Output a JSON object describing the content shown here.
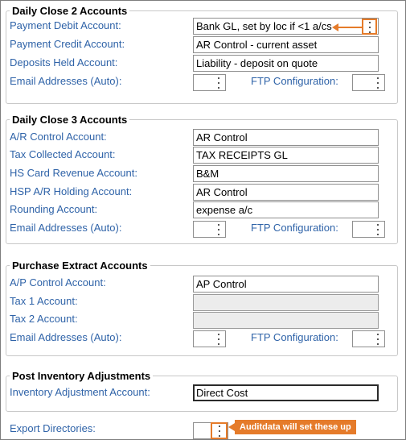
{
  "dc2": {
    "title": "Daily Close 2 Accounts",
    "payment_debit_label": "Payment Debit Account:",
    "payment_debit_value": "Bank GL, set by loc if <1 a/cs",
    "payment_credit_label": "Payment Credit Account:",
    "payment_credit_value": "AR Control - current asset",
    "deposits_held_label": "Deposits Held Account:",
    "deposits_held_value": "Liability - deposit on quote",
    "email_label": "Email Addresses (Auto):",
    "ftp_label": "FTP Configuration:"
  },
  "dc3": {
    "title": "Daily Close 3 Accounts",
    "ar_control_label": "A/R Control Account:",
    "ar_control_value": "AR Control",
    "tax_collected_label": "Tax Collected Account:",
    "tax_collected_value": "TAX RECEIPTS GL",
    "hs_card_label": "HS Card Revenue Account:",
    "hs_card_value": "B&M",
    "hsp_ar_label": "HSP A/R Holding Account:",
    "hsp_ar_value": "AR Control",
    "rounding_label": "Rounding Account:",
    "rounding_value": "expense a/c",
    "email_label": "Email Addresses (Auto):",
    "ftp_label": "FTP Configuration:"
  },
  "purchase": {
    "title": "Purchase Extract Accounts",
    "ap_control_label": "A/P Control Account:",
    "ap_control_value": "AP Control",
    "tax1_label": "Tax 1 Account:",
    "tax1_value": "",
    "tax2_label": "Tax 2 Account:",
    "tax2_value": "",
    "email_label": "Email Addresses (Auto):",
    "ftp_label": "FTP Configuration:"
  },
  "inventory": {
    "title": "Post Inventory Adjustments",
    "adjustment_label": "Inventory Adjustment Account:",
    "adjustment_value": "Direct Cost"
  },
  "export": {
    "label": "Export Directories:",
    "callout": "Auditdata will set these up"
  },
  "colors": {
    "label_blue": "#2f63a8",
    "highlight_orange": "#e57b2a"
  },
  "icons": {
    "picker": "vertical-ellipsis-icon",
    "annotation_arrow": "arrow-left-icon"
  }
}
